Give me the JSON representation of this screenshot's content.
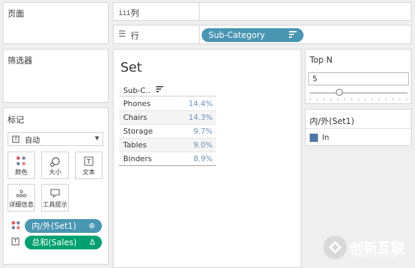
{
  "pages_panel": {
    "title": "页面"
  },
  "filters_panel": {
    "title": "筛选器"
  },
  "marks": {
    "title": "标记",
    "mark_type": "自动",
    "buttons": {
      "color": "颜色",
      "size": "大小",
      "label": "文本",
      "detail": "详细信息",
      "tooltip": "工具提示"
    },
    "fields": [
      {
        "name": "内/外(Set1)",
        "color": "#4996b2"
      },
      {
        "name": "总和(Sales)",
        "color": "#00a16e"
      }
    ]
  },
  "shelves": {
    "columns": {
      "icon": "iii",
      "label": "列"
    },
    "rows": {
      "icon": "☰",
      "label": "行",
      "pill": "Sub-Category"
    }
  },
  "view": {
    "title": "Set",
    "header": "Sub-C..",
    "rows": [
      {
        "category": "Phones",
        "value": "14.4%"
      },
      {
        "category": "Chairs",
        "value": "14.3%"
      },
      {
        "category": "Storage",
        "value": "9.7%"
      },
      {
        "category": "Tables",
        "value": "9.0%"
      },
      {
        "category": "Binders",
        "value": "8.9%"
      }
    ]
  },
  "top_n": {
    "title": "Top N",
    "value": "5",
    "slider_fraction": 0.3
  },
  "legend": {
    "title": "内/外(Set1)",
    "item": "In",
    "color": "#4e79a7"
  },
  "watermark": {
    "text": "创新互联",
    "sub": "CHUANGXIN HULIAN"
  }
}
